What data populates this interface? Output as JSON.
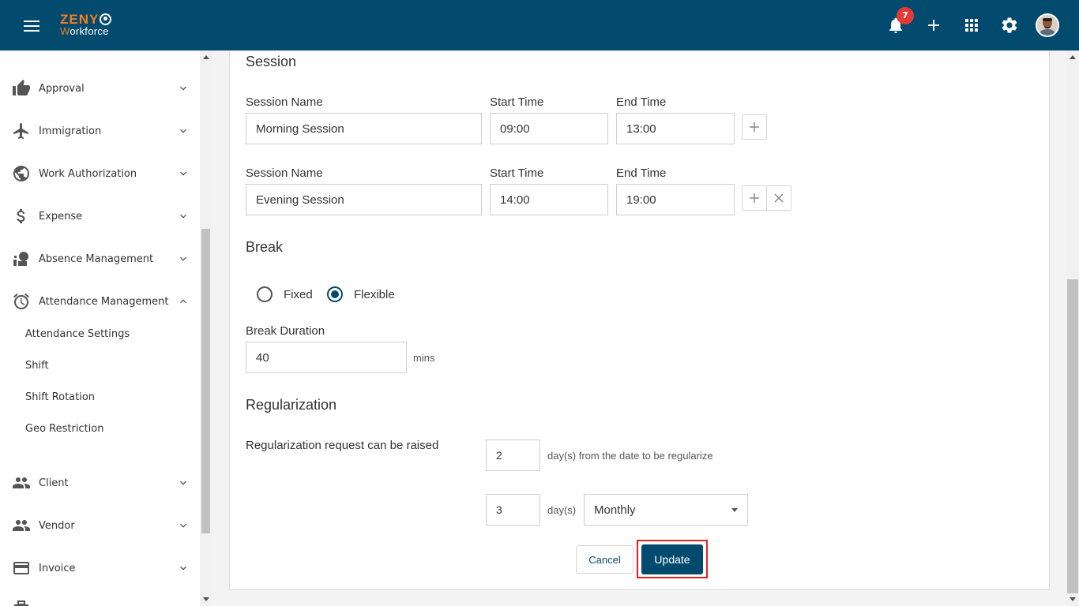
{
  "app": {
    "logo_top": "ZENY",
    "logo_bottom_accent": "W",
    "logo_bottom_rest": "orkforce",
    "notification_count": "7",
    "brand_color": "#034b6e",
    "accent_color": "#f57c1f"
  },
  "header_icons": [
    "menu-icon",
    "bell-icon",
    "plus-icon",
    "apps-grid-icon",
    "settings-icon",
    "avatar"
  ],
  "sidebar": {
    "items": [
      {
        "label": "Approval",
        "icon": "thumbs-up-icon"
      },
      {
        "label": "Immigration",
        "icon": "airplane-icon"
      },
      {
        "label": "Work Authorization",
        "icon": "globe-icon"
      },
      {
        "label": "Expense",
        "icon": "dollar-icon"
      },
      {
        "label": "Absence Management",
        "icon": "absence-icon"
      },
      {
        "label": "Attendance Management",
        "icon": "alarm-clock-icon"
      },
      {
        "label": "Client",
        "icon": "people-icon"
      },
      {
        "label": "Vendor",
        "icon": "people-icon"
      },
      {
        "label": "Invoice",
        "icon": "credit-card-icon"
      }
    ],
    "sub_items": [
      "Attendance Settings",
      "Shift",
      "Shift Rotation",
      "Geo Restriction"
    ]
  },
  "session": {
    "title": "Session",
    "rows": [
      {
        "name_label": "Session Name",
        "name_value": "Morning Session",
        "start_label": "Start Time",
        "start_value": "09:00",
        "end_label": "End Time",
        "end_value": "13:00"
      },
      {
        "name_label": "Session Name",
        "name_value": "Evening Session",
        "start_label": "Start Time",
        "start_value": "14:00",
        "end_label": "End Time",
        "end_value": "19:00"
      }
    ]
  },
  "break": {
    "title": "Break",
    "option_fixed": "Fixed",
    "option_flexible": "Flexible",
    "selected": "Flexible",
    "duration_label": "Break Duration",
    "duration_value": "40",
    "duration_unit": "mins"
  },
  "regularization": {
    "title": "Regularization",
    "request_label": "Regularization request can be raised",
    "days_value": "2",
    "days_hint": "day(s) from the date to be regularize",
    "count_value": "3",
    "count_hint": "day(s)",
    "period_value": "Monthly"
  },
  "actions": {
    "cancel_label": "Cancel",
    "update_label": "Update"
  }
}
